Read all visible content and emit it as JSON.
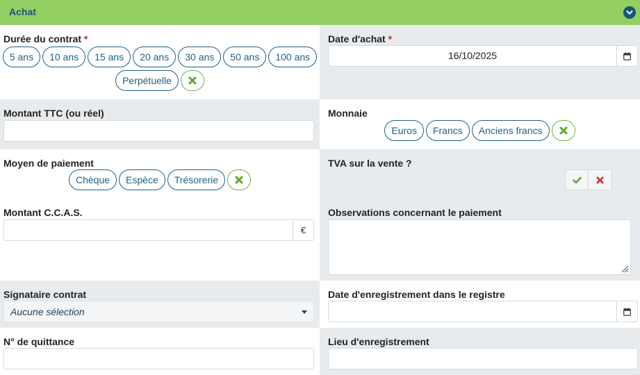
{
  "header": {
    "title": "Achat",
    "toggle_icon": "chevron-down-icon"
  },
  "duree": {
    "label": "Durée du contrat",
    "required_mark": "*",
    "options": [
      "5 ans",
      "10 ans",
      "15 ans",
      "20 ans",
      "30 ans",
      "50 ans",
      "100 ans",
      "Perpétuelle"
    ]
  },
  "date_achat": {
    "label": "Date d'achat",
    "required_mark": "*",
    "value": "16/10/2025",
    "icon": "calendar-icon"
  },
  "montant_ttc": {
    "label": "Montant TTC (ou réel)",
    "value": ""
  },
  "monnaie": {
    "label": "Monnaie",
    "options": [
      "Euros",
      "Francs",
      "Anciens francs"
    ]
  },
  "moyen_paiement": {
    "label": "Moyen de paiement",
    "options": [
      "Chèque",
      "Espèce",
      "Trésorerie"
    ]
  },
  "tva": {
    "label": "TVA sur la vente ?",
    "yes_icon": "check-icon",
    "no_icon": "x-icon"
  },
  "montant_ccas": {
    "label": "Montant C.C.A.S.",
    "value": "",
    "unit": "€"
  },
  "observations": {
    "label": "Observations concernant le paiement",
    "value": ""
  },
  "signataire": {
    "label": "Signataire contrat",
    "selected": "Aucune sélection"
  },
  "date_enregistrement": {
    "label": "Date d'enregistrement dans le registre",
    "value": "",
    "icon": "calendar-icon"
  },
  "quittance": {
    "label": "N° de quittance",
    "value": ""
  },
  "lieu_enregistrement": {
    "label": "Lieu d'enregistrement",
    "value": ""
  },
  "colors": {
    "header_green": "#94cf64",
    "title_blue": "#17567a",
    "pill_blue": "#1f5f86",
    "clear_green": "#5ea72c",
    "check_green": "#5ea72c",
    "cross_red": "#d32f2f",
    "required_red": "#c62828"
  }
}
